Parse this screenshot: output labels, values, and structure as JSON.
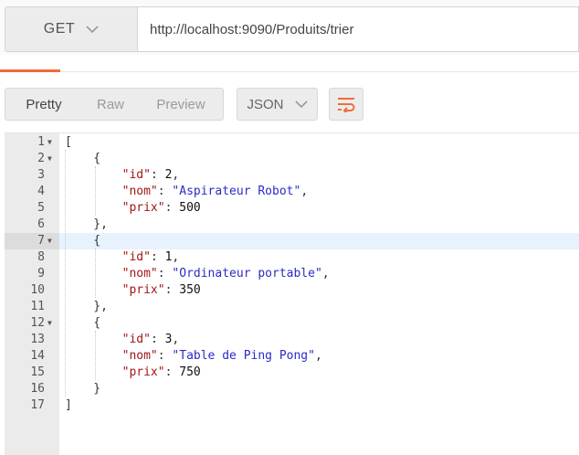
{
  "request": {
    "method": "GET",
    "url": "http://localhost:9090/Produits/trier"
  },
  "response_toolbar": {
    "views": [
      "Pretty",
      "Raw",
      "Preview"
    ],
    "active_view": "Pretty",
    "format": "JSON"
  },
  "colors": {
    "accent": "#f26b3a",
    "json_key": "#a31515",
    "json_string": "#2a2ac8",
    "highlight": "#e8f2fe"
  },
  "code": {
    "highlighted_line": 7,
    "lines": [
      {
        "n": "1",
        "fold": true,
        "text": "["
      },
      {
        "n": "2",
        "fold": true,
        "text": "    {"
      },
      {
        "n": "3",
        "fold": false,
        "text": "        \"id\": 2,"
      },
      {
        "n": "4",
        "fold": false,
        "text": "        \"nom\": \"Aspirateur Robot\","
      },
      {
        "n": "5",
        "fold": false,
        "text": "        \"prix\": 500"
      },
      {
        "n": "6",
        "fold": false,
        "text": "    },"
      },
      {
        "n": "7",
        "fold": true,
        "text": "    {"
      },
      {
        "n": "8",
        "fold": false,
        "text": "        \"id\": 1,"
      },
      {
        "n": "9",
        "fold": false,
        "text": "        \"nom\": \"Ordinateur portable\","
      },
      {
        "n": "10",
        "fold": false,
        "text": "        \"prix\": 350"
      },
      {
        "n": "11",
        "fold": false,
        "text": "    },"
      },
      {
        "n": "12",
        "fold": true,
        "text": "    {"
      },
      {
        "n": "13",
        "fold": false,
        "text": "        \"id\": 3,"
      },
      {
        "n": "14",
        "fold": false,
        "text": "        \"nom\": \"Table de Ping Pong\","
      },
      {
        "n": "15",
        "fold": false,
        "text": "        \"prix\": 750"
      },
      {
        "n": "16",
        "fold": false,
        "text": "    }"
      },
      {
        "n": "17",
        "fold": false,
        "text": "]"
      }
    ]
  }
}
